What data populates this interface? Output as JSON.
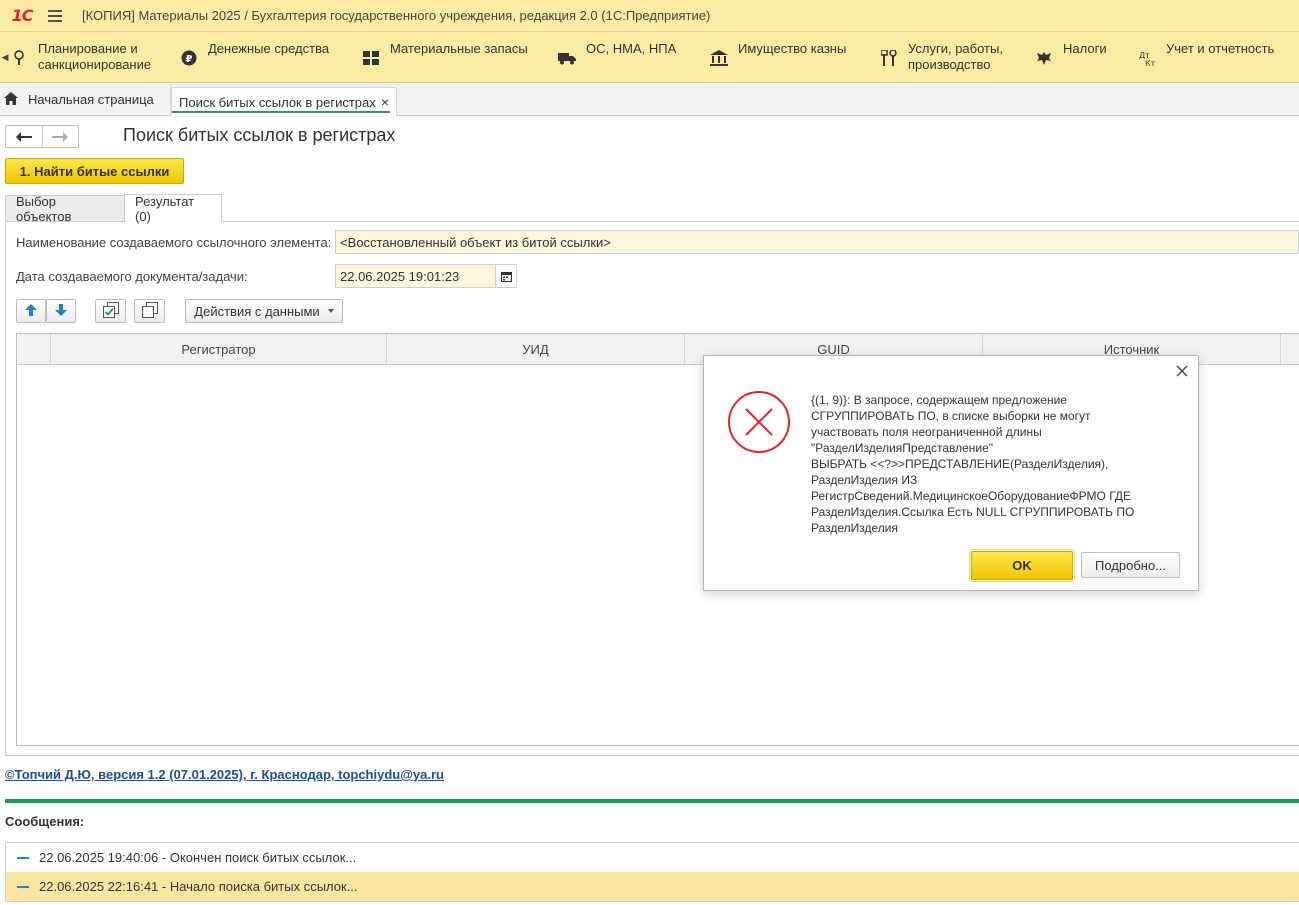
{
  "window": {
    "logo": "1С",
    "title": "[КОПИЯ] Материалы 2025 / Бухгалтерия государственного учреждения, редакция 2.0  (1С:Предприятие)"
  },
  "sections": [
    {
      "line1": "Планирование и",
      "line2": "санкционирование",
      "icon": "planning-icon"
    },
    {
      "line1": "Денежные средства",
      "line2": "",
      "icon": "ruble-icon"
    },
    {
      "line1": "Материальные запасы",
      "line2": "",
      "icon": "grid-icon"
    },
    {
      "line1": "ОС, НМА, НПА",
      "line2": "",
      "icon": "truck-icon"
    },
    {
      "line1": "Имущество казны",
      "line2": "",
      "icon": "bank-icon"
    },
    {
      "line1": "Услуги, работы,",
      "line2": "производство",
      "icon": "tools-icon"
    },
    {
      "line1": "Налоги",
      "line2": "",
      "icon": "eagle-icon"
    },
    {
      "line1": "Учет и отчетность",
      "line2": "",
      "icon": "debit-credit-icon"
    }
  ],
  "tabs": {
    "home": "Начальная страница",
    "active": "Поиск битых ссылок в регистрах",
    "close": "×"
  },
  "form": {
    "title": "Поиск битых ссылок в регистрах",
    "find_button": "1. Найти битые ссылки",
    "tab_select": "Выбор объектов",
    "tab_result": "Результат (0)",
    "name_label": "Наименование создаваемого ссылочного элемента:",
    "name_value": "<Восстановленный объект из битой ссылки>",
    "date_label": "Дата создаваемого документа/задачи:",
    "date_value": "22.06.2025 19:01:23",
    "actions_button": "Действия с данными",
    "columns": [
      "Регистратор",
      "УИД",
      "GUID",
      "Источник"
    ]
  },
  "footer": {
    "author": "©Топчий Д.Ю, версия 1.2 (07.01.2025),  г. Краснодар, topchiydu@ya.ru",
    "messages_title": "Сообщения:",
    "messages": [
      "22.06.2025 19:40:06 - Окончен поиск битых ссылок...",
      "22.06.2025 22:16:41 - Начало поиска битых ссылок..."
    ]
  },
  "dialog": {
    "message": "{(1, 9)}: В запросе, содержащем предложение\nСГРУППИРОВАТЬ ПО, в списке выборки не могут\nучаствовать поля неограниченной длины\n\"РазделИзделияПредставление\"\nВЫБРАТЬ <<?>>ПРЕДСТАВЛЕНИЕ(РазделИзделия),\nРазделИзделия ИЗ\nРегистрСведений.МедицинскоеОборудованиеФРМО ГДЕ\nРазделИзделия.Ссылка Есть NULL СГРУППИРОВАТЬ ПО\nРазделИзделия",
    "ok": "OK",
    "more": "Подробно..."
  },
  "colors": {
    "accent_yellow": "#f2c500",
    "panel_yellow": "#fbeca4",
    "error_red": "#e1242a",
    "green": "#1f9e4e"
  }
}
